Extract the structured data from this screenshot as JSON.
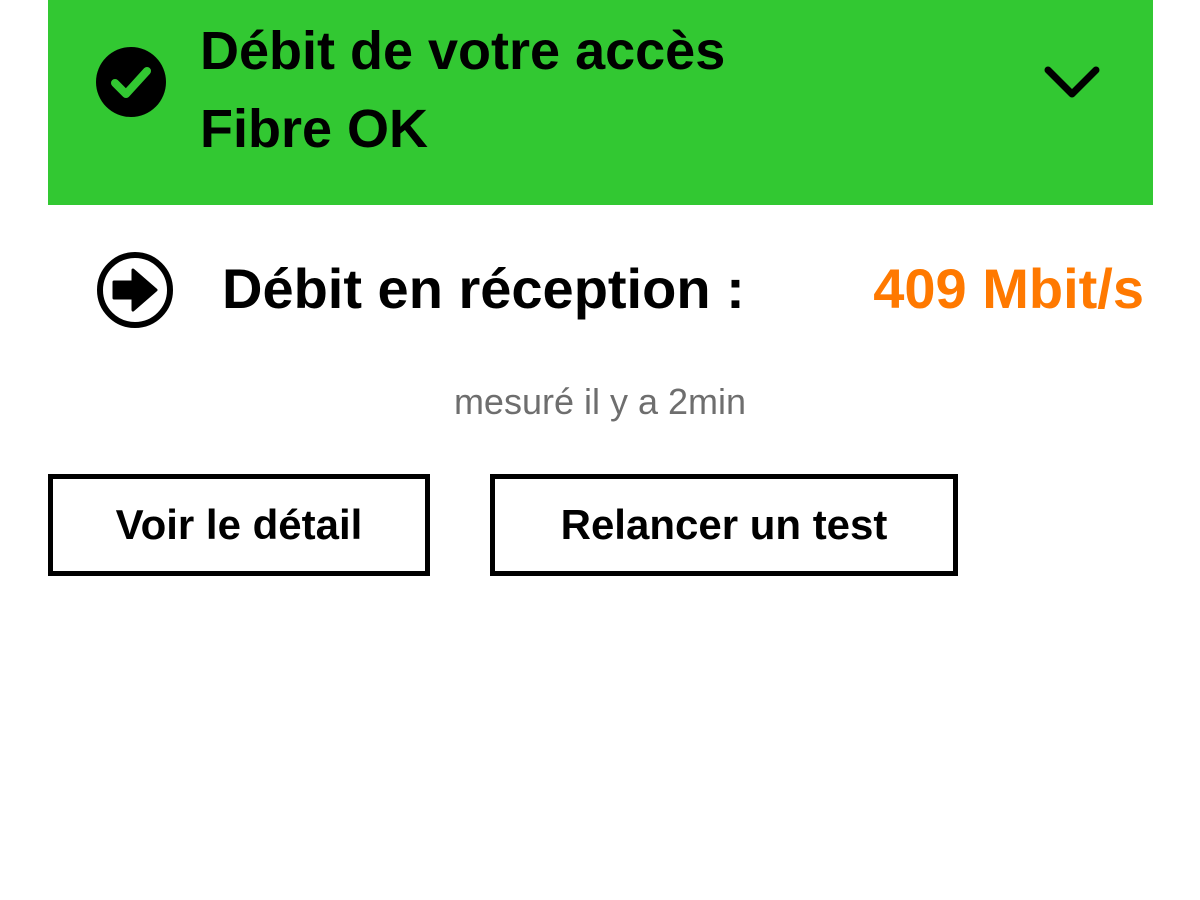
{
  "status": {
    "line1": "Débit de votre accès",
    "line2": "Fibre OK",
    "color": "#32c832",
    "icon": "check-circle-icon",
    "expand_icon": "chevron-down-icon"
  },
  "download": {
    "label": "Débit en réception :",
    "value": "409 Mbit/s",
    "value_color": "#ff7900",
    "icon": "arrow-right-circle-icon",
    "measured": "mesuré il y a 2min"
  },
  "actions": {
    "detail_label": "Voir le détail",
    "retest_label": "Relancer un test"
  }
}
